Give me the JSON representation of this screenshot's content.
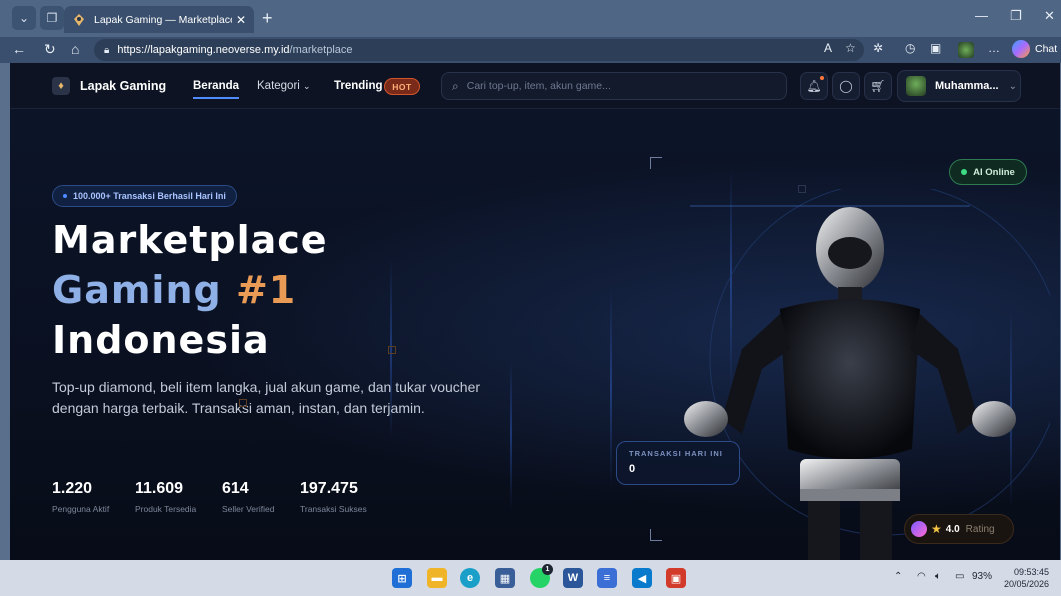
{
  "browser": {
    "tab_title": "Lapak Gaming — Marketplace Gar",
    "tab_close": "✕",
    "new_tab": "+",
    "url_host": "https://lapakgaming.neoverse.my.id",
    "url_path": "/marketplace",
    "chat_label": "Chat",
    "icons": [
      "menu-chevron-icon",
      "workspaces-icon",
      "back-icon",
      "refresh-icon",
      "home-icon",
      "lock-icon",
      "read-aloud-icon",
      "favorite-icon",
      "extensions-icon",
      "browser-essentials-icon",
      "collections-icon",
      "profile-icon",
      "more-icon",
      "copilot-icon"
    ]
  },
  "nav": {
    "logo_text": "Lapak Gaming",
    "links": {
      "beranda": "Beranda",
      "kategori": "Kategori",
      "trending": "Trending"
    },
    "hot_badge": "HOT",
    "search_placeholder": "Cari top-up, item, akun game...",
    "user_name": "Muhamma..."
  },
  "hero": {
    "pill": "100.000+ Transaksi Berhasil Hari Ini",
    "title_line1": "Marketplace",
    "title_line2_a": "Gaming",
    "title_line2_b": "#1",
    "title_line3": "Indonesia",
    "description": "Top-up diamond, beli item langka, jual akun game, dan tukar voucher dengan harga terbaik. Transaksi aman, instan, dan terjamin.",
    "stats": [
      {
        "value": "1.220",
        "label": "Pengguna Aktif"
      },
      {
        "value": "11.609",
        "label": "Produk Tersedia"
      },
      {
        "value": "614",
        "label": "Seller Verified"
      },
      {
        "value": "197.475",
        "label": "Transaksi Sukses"
      }
    ],
    "ai_badge": "AI Online",
    "tx_card_label": "TRANSAKSI HARI INI",
    "tx_card_value": "0",
    "rating_value": "4.0",
    "rating_label": "Rating"
  },
  "taskbar": {
    "battery": "93%",
    "time": "09:53:45",
    "date": "20/05/2026",
    "whatsapp_badge": "1"
  },
  "colors": {
    "accent_blue": "#4f8cff",
    "title_blue": "#8fb0e6",
    "title_orange": "#e99a55",
    "hot": "#d0552e",
    "online_green": "#3ddc84"
  }
}
